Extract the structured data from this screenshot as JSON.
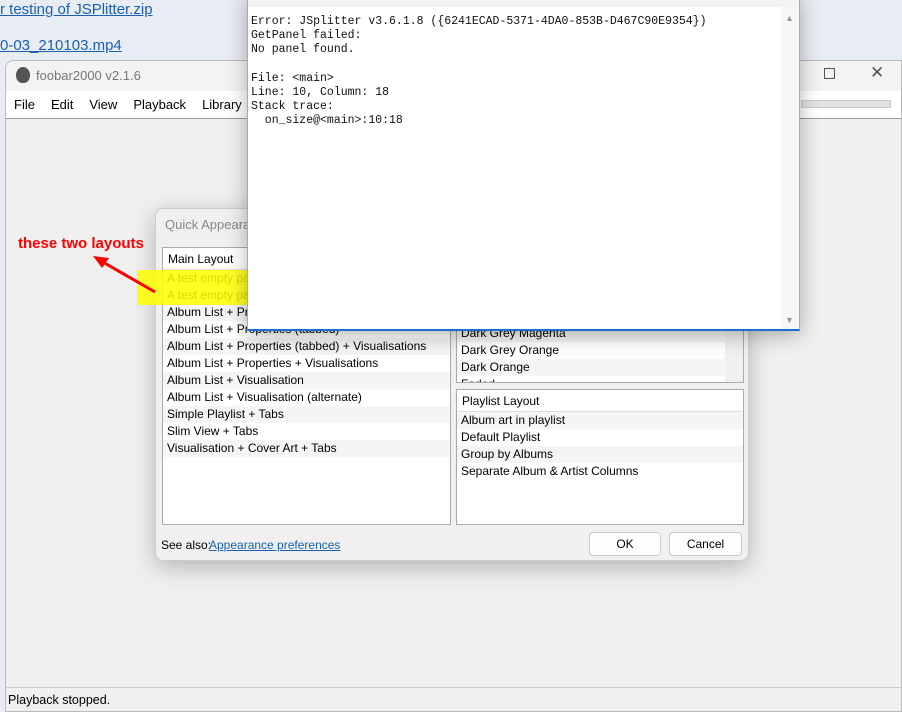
{
  "background": {
    "links": [
      "r testing of JSPlitter.zip",
      "0-03_210103.mp4"
    ]
  },
  "foobar": {
    "title": "foobar2000 v2.1.6",
    "menu": [
      "File",
      "Edit",
      "View",
      "Playback",
      "Library"
    ],
    "status": "Playback stopped."
  },
  "dialog": {
    "title": "Quick Appearance Setup",
    "main_layout": {
      "header": "Main Layout",
      "items": [
        "A test empty par",
        "A test empty par",
        "Album List + Properties",
        "Album List + Properties (tabbed)",
        "Album List + Properties (tabbed) + Visualisations",
        "Album List + Properties + Visualisations",
        "Album List + Visualisation",
        "Album List + Visualisation (alternate)",
        "Simple Playlist + Tabs",
        "Slim View + Tabs",
        "Visualisation + Cover Art + Tabs"
      ]
    },
    "colours": {
      "items": [
        "Dark Grey Magenta",
        "Dark Grey Orange",
        "Dark Orange",
        "Faded"
      ]
    },
    "playlist_layout": {
      "header": "Playlist Layout",
      "items": [
        "Album art in playlist",
        "Default Playlist",
        "Group by Albums",
        "Separate Album & Artist Columns"
      ]
    },
    "see_also": "See also:",
    "see_also_link": "Appearance preferences",
    "ok": "OK",
    "cancel": "Cancel"
  },
  "error": {
    "text": "Error: JSplitter v3.6.1.8 ({6241ECAD-5371-4DA0-853B-D467C90E9354})\nGetPanel failed:\nNo panel found.\n\nFile: <main>\nLine: 10, Column: 18\nStack trace:\n  on_size@<main>:10:18"
  },
  "annotation": "these two layouts"
}
